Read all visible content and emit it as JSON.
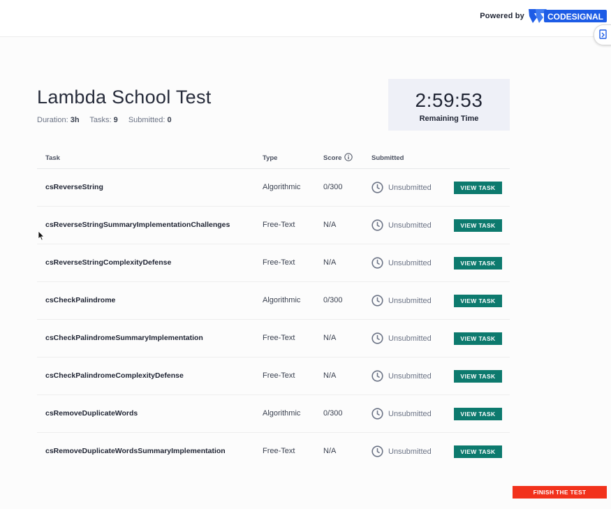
{
  "header": {
    "powered_by": "Powered by",
    "logo_text": "CODESIGNAL",
    "logo_color": "#1d5ce6"
  },
  "test": {
    "title": "Lambda School Test",
    "duration_label": "Duration:",
    "duration_value": "3h",
    "tasks_label": "Tasks:",
    "tasks_value": "9",
    "submitted_label": "Submitted:",
    "submitted_value": "0"
  },
  "timer": {
    "time": "2:59:53",
    "label": "Remaining Time"
  },
  "table": {
    "headers": {
      "task": "Task",
      "type": "Type",
      "score": "Score",
      "submitted": "Submitted"
    },
    "rows": [
      {
        "task": "csReverseString",
        "type": "Algorithmic",
        "score": "0/300",
        "status": "Unsubmitted",
        "action": "VIEW TASK"
      },
      {
        "task": "csReverseStringSummaryImplementationChallenges",
        "type": "Free-Text",
        "score": "N/A",
        "status": "Unsubmitted",
        "action": "VIEW TASK"
      },
      {
        "task": "csReverseStringComplexityDefense",
        "type": "Free-Text",
        "score": "N/A",
        "status": "Unsubmitted",
        "action": "VIEW TASK"
      },
      {
        "task": "csCheckPalindrome",
        "type": "Algorithmic",
        "score": "0/300",
        "status": "Unsubmitted",
        "action": "VIEW TASK"
      },
      {
        "task": "csCheckPalindromeSummaryImplementation",
        "type": "Free-Text",
        "score": "N/A",
        "status": "Unsubmitted",
        "action": "VIEW TASK"
      },
      {
        "task": "csCheckPalindromeComplexityDefense",
        "type": "Free-Text",
        "score": "N/A",
        "status": "Unsubmitted",
        "action": "VIEW TASK"
      },
      {
        "task": "csRemoveDuplicateWords",
        "type": "Algorithmic",
        "score": "0/300",
        "status": "Unsubmitted",
        "action": "VIEW TASK"
      },
      {
        "task": "csRemoveDuplicateWordsSummaryImplementation",
        "type": "Free-Text",
        "score": "N/A",
        "status": "Unsubmitted",
        "action": "VIEW TASK"
      }
    ]
  },
  "footer": {
    "finish_label": "FINISH THE TEST"
  },
  "colors": {
    "view_button": "#0d7a6e",
    "finish_button": "#f2321c",
    "timer_bg": "#eef0f7"
  },
  "icons": [
    "codesignal-logo-icon",
    "share-icon",
    "info-icon",
    "clock-icon",
    "mouse-cursor-icon"
  ]
}
